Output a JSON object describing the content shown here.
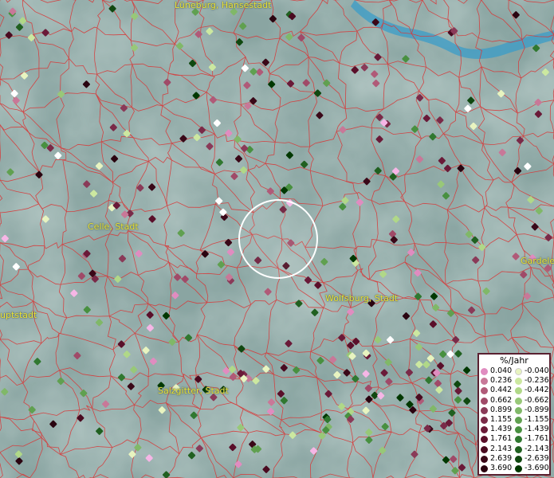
{
  "map": {
    "labels": [
      {
        "id": "lueneburg",
        "text": "Lüneburg, Hansestadt"
      },
      {
        "id": "celle",
        "text": "Celle, Stadt"
      },
      {
        "id": "gardelegen",
        "text": "Gardeleg"
      },
      {
        "id": "wolfsburg",
        "text": "Wolfsburg, Stadt"
      },
      {
        "id": "hauptstadt",
        "text": "uptstadt"
      },
      {
        "id": "salzgitter",
        "text": "Salzgitter, Stadt"
      }
    ],
    "colors": {
      "border": "#d83838",
      "water": "#3a9cc8",
      "label": "#e8e23a",
      "pos_scale": [
        "#f6b6e6",
        "#e08cc0",
        "#c87898",
        "#b05a78",
        "#a04a68",
        "#8a3a58",
        "#7a2a48",
        "#6a1a38",
        "#5a0f2a",
        "#4a0a20",
        "#3a0818",
        "#2a0410"
      ],
      "neg_scale": [
        "#ffffff",
        "#e8f4c0",
        "#cce8a0",
        "#b0d888",
        "#98c878",
        "#80b868",
        "#60a050",
        "#489040",
        "#307830",
        "#206020",
        "#104810",
        "#003800"
      ]
    }
  },
  "legend": {
    "title": "%/Jahr",
    "positive": [
      "0.040",
      "0.236",
      "0.442",
      "0.662",
      "0.899",
      "1.155",
      "1.439",
      "1.761",
      "2.143",
      "2.639",
      "3.690"
    ],
    "negative": [
      "-0.040",
      "-0.236",
      "-0.442",
      "-0.662",
      "-0.899",
      "-1.155",
      "-1.439",
      "-1.761",
      "-2.143",
      "-2.639",
      "-3.690"
    ]
  }
}
